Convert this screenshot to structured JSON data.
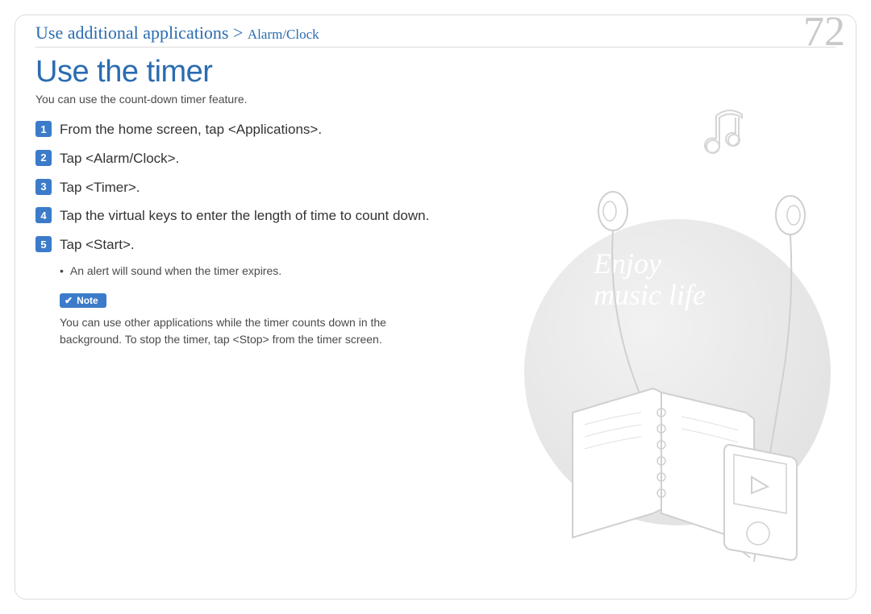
{
  "breadcrumb": {
    "main": "Use additional applications > ",
    "sub": "Alarm/Clock"
  },
  "page_number": "72",
  "section_title": "Use the timer",
  "intro": "You can use the count-down timer feature.",
  "steps": [
    {
      "n": "1",
      "text": "From the home screen, tap <Applications>."
    },
    {
      "n": "2",
      "text": "Tap <Alarm/Clock>."
    },
    {
      "n": "3",
      "text": "Tap <Timer>."
    },
    {
      "n": "4",
      "text": "Tap the virtual keys to enter the length of time to count down."
    },
    {
      "n": "5",
      "text": "Tap <Start>."
    }
  ],
  "sub_bullet": "An alert will sound when the timer expires.",
  "note": {
    "label": "Note",
    "text": "You can use other applications while the timer counts down in the background. To stop the timer, tap <Stop> from the timer screen."
  },
  "decorative": {
    "line1": "Enjoy",
    "line2": "music life"
  }
}
